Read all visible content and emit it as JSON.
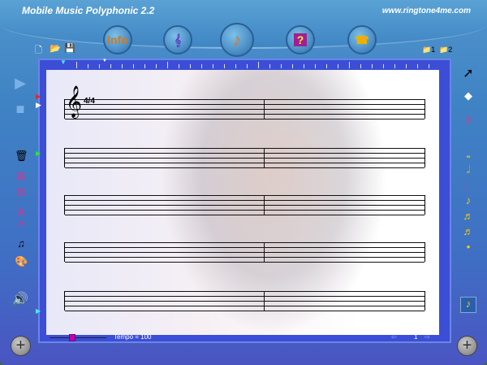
{
  "app": {
    "title": "Mobile Music Polyphonic  2.2",
    "url": "www.ringtone4me.com"
  },
  "nav": [
    {
      "label": "Info",
      "icon": "info-icon"
    },
    {
      "label": "",
      "icon": "instrument-icon"
    },
    {
      "label": "",
      "icon": "score-note-icon"
    },
    {
      "label": "",
      "icon": "help-book-icon"
    },
    {
      "label": "",
      "icon": "phone-send-icon"
    }
  ],
  "file_toolbar": {
    "new": "new-file-icon",
    "open": "open-folder-icon",
    "save": "save-icon"
  },
  "slots": [
    "1",
    "2"
  ],
  "score": {
    "time_signature": "4/4",
    "clef": "treble",
    "staves": 5
  },
  "footer": {
    "tempo_label": "Tempo = 100",
    "tempo": 100,
    "page": "1"
  },
  "right_tools": [
    "pointer",
    "eraser",
    "note"
  ],
  "durations": [
    "whole",
    "half",
    "quarter",
    "eighth",
    "sixteenth",
    "thirty-second",
    "dot"
  ]
}
